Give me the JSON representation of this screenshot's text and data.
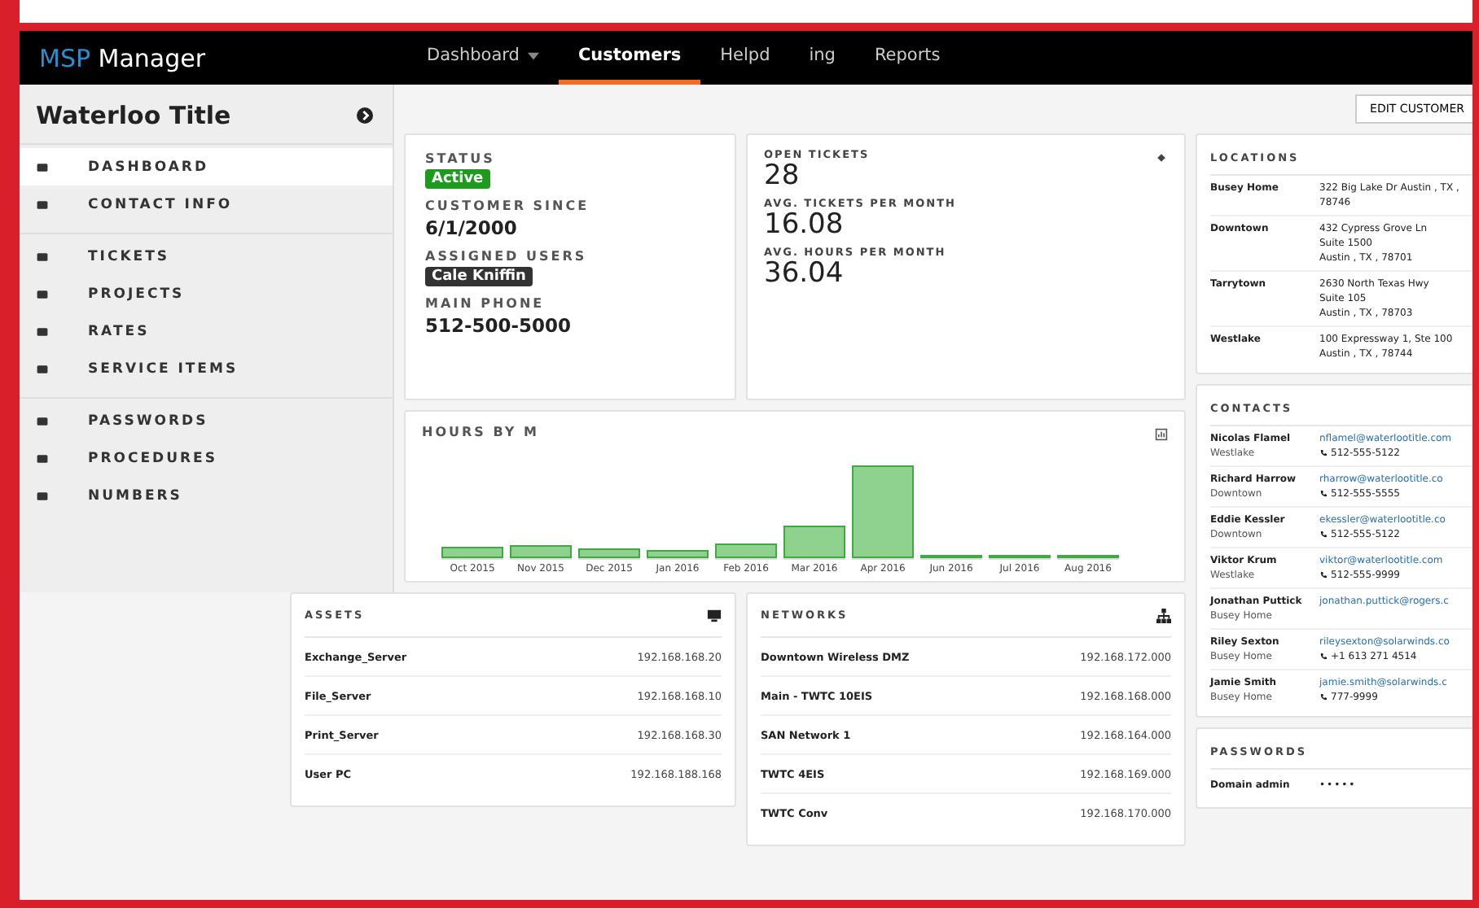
{
  "app": {
    "logo_accent": "MSP",
    "logo_rest": "Manager"
  },
  "nav": [
    {
      "label": "Dashboard",
      "caret": true,
      "selected": false
    },
    {
      "label": "Customers",
      "caret": false,
      "selected": true
    },
    {
      "label": "Helpd",
      "caret": false,
      "selected": false
    },
    {
      "label": "ing",
      "caret": false,
      "selected": false
    },
    {
      "label": "Reports",
      "caret": false,
      "selected": false
    }
  ],
  "toolbar": {
    "edit_button": "EDIT CUSTOMER"
  },
  "sidebar": {
    "title": "Waterloo Title",
    "groups": [
      [
        {
          "label": "DASHBOARD",
          "selected": true
        },
        {
          "label": "CONTACT INFO",
          "selected": false
        }
      ],
      [
        {
          "label": "TICKETS",
          "selected": false
        },
        {
          "label": "PROJECTS",
          "selected": false
        },
        {
          "label": "RATES",
          "selected": false
        },
        {
          "label": "SERVICE ITEMS",
          "selected": false
        }
      ],
      [
        {
          "label": "PASSWORDS",
          "selected": false
        },
        {
          "label": "PROCEDURES",
          "selected": false
        },
        {
          "label": "NUMBERS",
          "selected": false
        }
      ]
    ]
  },
  "summary": [
    {
      "label": "STATUS",
      "value": "Active",
      "kind": "status"
    },
    {
      "label": "CUSTOMER SINCE",
      "value": "6/1/2000",
      "kind": "text"
    },
    {
      "label": "ASSIGNED USERS",
      "value": "Cale Kniffin",
      "kind": "user"
    },
    {
      "label": "MAIN PHONE",
      "value": "512-500-5000",
      "kind": "text"
    }
  ],
  "stats": [
    {
      "label": "OPEN TICKETS",
      "value": "28"
    },
    {
      "label": "AVG. TICKETS PER MONTH",
      "value": "16.08"
    },
    {
      "label": "AVG. HOURS PER MONTH",
      "value": "36.04"
    }
  ],
  "hours_chart": {
    "title": "HOURS BY M",
    "months": [
      "Oct 2015",
      "Nov 2015",
      "Dec 2015",
      "Jan 2016",
      "Feb 2016",
      "Mar 2016",
      "Apr 2016",
      "Jun 2016",
      "Jul 2016",
      "Aug 2016"
    ]
  },
  "assets": {
    "title": "ASSETS",
    "rows": [
      {
        "name": "Exchange_Server",
        "ip": "192.168.168.20"
      },
      {
        "name": "File_Server",
        "ip": "192.168.168.10"
      },
      {
        "name": "Print_Server",
        "ip": "192.168.168.30"
      },
      {
        "name": "User PC",
        "ip": "192.168.188.168"
      }
    ]
  },
  "networks": {
    "title": "NETWORKS",
    "rows": [
      {
        "name": "Downtown Wireless DMZ",
        "ip": "192.168.172.000"
      },
      {
        "name": "Main - TWTC 10EIS",
        "ip": "192.168.168.000"
      },
      {
        "name": "SAN Network 1",
        "ip": "192.168.164.000"
      },
      {
        "name": "TWTC 4EIS",
        "ip": "192.168.169.000"
      },
      {
        "name": "TWTC Conv",
        "ip": "192.168.170.000"
      }
    ]
  },
  "locations": {
    "title": "LOCATIONS",
    "rows": [
      {
        "name": "Busey Home",
        "address": [
          "322 Big Lake Dr Austin , TX ,",
          "78746"
        ]
      },
      {
        "name": "Downtown",
        "address": [
          "432 Cypress Grove Ln",
          "Suite 1500",
          "Austin , TX , 78701"
        ]
      },
      {
        "name": "Tarrytown",
        "address": [
          "2630 North Texas Hwy",
          "Suite 105",
          "Austin , TX , 78703"
        ]
      },
      {
        "name": "Westlake",
        "address": [
          "100 Expressway 1, Ste 100",
          "Austin , TX , 78744"
        ]
      }
    ]
  },
  "contacts": {
    "title": "CONTACTS",
    "rows": [
      {
        "name": "Nicolas Flamel",
        "place": "Westlake",
        "email": "nflamel@waterlootitle.com",
        "phone": "512-555-5122"
      },
      {
        "name": "Richard Harrow",
        "place": "Downtown",
        "email": "rharrow@waterlootitle.co",
        "phone": "512-555-5555"
      },
      {
        "name": "Eddie Kessler",
        "place": "Downtown",
        "email": "ekessler@waterlootitle.co",
        "phone": "512-555-5122"
      },
      {
        "name": "Viktor Krum",
        "place": "Westlake",
        "email": "viktor@waterlootitle.com",
        "phone": "512-555-9999"
      },
      {
        "name": "Jonathan Puttick",
        "place": "Busey Home",
        "email": "jonathan.puttick@rogers.c"
      },
      {
        "name": "Riley Sexton",
        "place": "Busey Home",
        "email": "rileysexton@solarwinds.co",
        "phone": "+1 613 271 4514"
      },
      {
        "name": "Jamie Smith",
        "place": "Busey Home",
        "email": "jamie.smith@solarwinds.c",
        "phone": "777-9999"
      }
    ]
  },
  "passwords": {
    "title": "PASSWORDS",
    "rows": [
      {
        "name": "Domain admin",
        "secret": "•••••"
      }
    ]
  }
}
